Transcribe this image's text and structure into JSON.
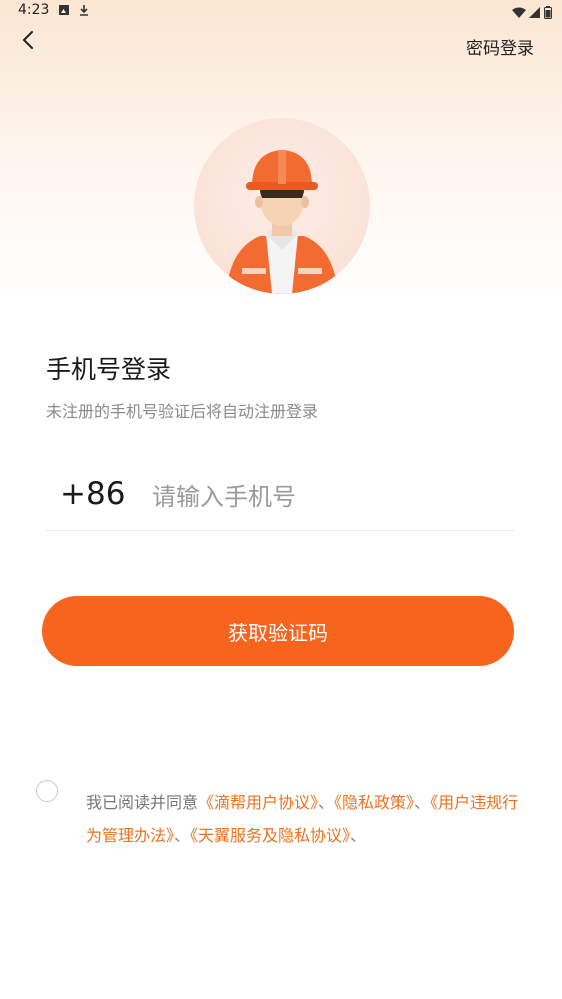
{
  "status_bar": {
    "time": "4:23"
  },
  "header": {
    "password_login": "密码登录"
  },
  "login": {
    "title": "手机号登录",
    "subtitle": "未注册的手机号验证后将自动注册登录",
    "country_code": "+86",
    "phone_placeholder": "请输入手机号",
    "get_code_button": "获取验证码"
  },
  "agreement": {
    "prefix": "我已阅读并同意",
    "separator": "、",
    "links": [
      "《滴帮用户协议》",
      "《隐私政策》",
      "《用户违规行为管理办法》",
      "《天翼服务及隐私协议》"
    ]
  },
  "colors": {
    "accent": "#f7641e",
    "link": "#f0711e",
    "avatar_helmet": "#f26b30"
  },
  "icons": [
    "back-arrow-icon",
    "avatar-icon",
    "wifi-icon",
    "signal-icon",
    "battery-icon",
    "gallery-notification-icon",
    "download-notification-icon"
  ]
}
